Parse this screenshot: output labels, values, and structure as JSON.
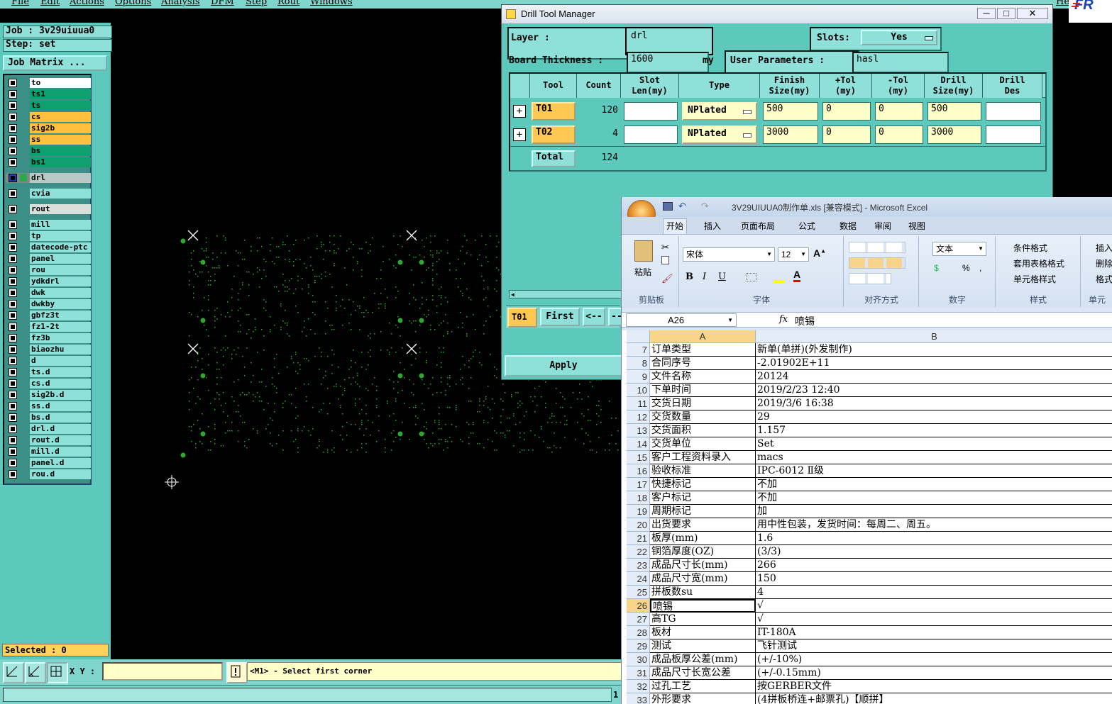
{
  "menubar": {
    "items": [
      "File",
      "Edit",
      "Actions",
      "Options",
      "Analysis",
      "DFM",
      "Step",
      "Rout",
      "Windows"
    ],
    "help": "Help",
    "logo": "FR"
  },
  "left": {
    "job": "Job : 3v29uiuua0",
    "step": "Step: set",
    "job_matrix": "Job Matrix ...",
    "layers": [
      {
        "name": "to",
        "color": "#ffffff"
      },
      {
        "name": "ts1",
        "color": "#10a070"
      },
      {
        "name": "ts",
        "color": "#10a070"
      },
      {
        "name": "cs",
        "color": "#ffc040"
      },
      {
        "name": "sig2b",
        "color": "#ffc040"
      },
      {
        "name": "ss",
        "color": "#ffc040"
      },
      {
        "name": "bs",
        "color": "#10a070"
      },
      {
        "name": "bs1",
        "color": "#10a070"
      },
      {
        "name": "drl",
        "color": "#b8c8c4"
      },
      {
        "name": "cvia",
        "color": "#8fe0d8"
      },
      {
        "name": "rout",
        "color": "#d8e0dc"
      },
      {
        "name": "mill",
        "color": "#8fe0d8"
      },
      {
        "name": "tp",
        "color": "#8fe0d8"
      },
      {
        "name": "datecode-ptc",
        "color": "#8fe0d8"
      },
      {
        "name": "panel",
        "color": "#8fe0d8"
      },
      {
        "name": "rou",
        "color": "#8fe0d8"
      },
      {
        "name": "ydkdrl",
        "color": "#8fe0d8"
      },
      {
        "name": "dwk",
        "color": "#8fe0d8"
      },
      {
        "name": "dwkby",
        "color": "#8fe0d8"
      },
      {
        "name": "gbfz3t",
        "color": "#8fe0d8"
      },
      {
        "name": "fz1-2t",
        "color": "#8fe0d8"
      },
      {
        "name": "fz3b",
        "color": "#8fe0d8"
      },
      {
        "name": "biaozhu",
        "color": "#8fe0d8"
      },
      {
        "name": "d",
        "color": "#8fe0d8"
      },
      {
        "name": "ts.d",
        "color": "#8fe0d8"
      },
      {
        "name": "cs.d",
        "color": "#8fe0d8"
      },
      {
        "name": "sig2b.d",
        "color": "#8fe0d8"
      },
      {
        "name": "ss.d",
        "color": "#8fe0d8"
      },
      {
        "name": "bs.d",
        "color": "#8fe0d8"
      },
      {
        "name": "drl.d",
        "color": "#8fe0d8"
      },
      {
        "name": "rout.d",
        "color": "#8fe0d8"
      },
      {
        "name": "mill.d",
        "color": "#8fe0d8"
      },
      {
        "name": "panel.d",
        "color": "#8fe0d8"
      },
      {
        "name": "rou.d",
        "color": "#8fe0d8"
      }
    ],
    "selected": "Selected : 0"
  },
  "bottom": {
    "xy_label": "X Y :",
    "xy_value": "",
    "message": "<M1> - Select first corner",
    "status_num": "1"
  },
  "dtm": {
    "title": "Drill Tool Manager",
    "layer_label": "Layer          :",
    "layer_value": "drl",
    "slots_label": "Slots:",
    "slots_value": "Yes",
    "thickness_label": "Board Thickness :",
    "thickness_value": "1600",
    "thickness_unit": "my",
    "userparam_label": "User Parameters :",
    "userparam_value": "hasl",
    "headers": [
      "Tool",
      "Count",
      "Slot\nLen(my)",
      "Type",
      "Finish\nSize(my)",
      "+Tol\n(my)",
      "-Tol\n(my)",
      "Drill\nSize(my)",
      "Drill\nDes"
    ],
    "rows": [
      {
        "tool": "T01",
        "count": "120",
        "slot": "",
        "type": "NPlated",
        "finish": "500",
        "ptol": "0",
        "mtol": "0",
        "drill": "500",
        "des": ""
      },
      {
        "tool": "T02",
        "count": "4",
        "slot": "",
        "type": "NPlated",
        "finish": "3000",
        "ptol": "0",
        "mtol": "0",
        "drill": "3000",
        "des": ""
      }
    ],
    "total_label": "Total",
    "total_count": "124",
    "current_tool": "T01",
    "first_btn": "First",
    "prev_btn": "<--",
    "next_btn": "--",
    "apply_btn": "Apply"
  },
  "excel": {
    "title": "3V29UIUUA0制作单.xls  [兼容模式] - Microsoft Excel",
    "tabs": [
      "开始",
      "插入",
      "页面布局",
      "公式",
      "数据",
      "审阅",
      "视图"
    ],
    "font_name": "宋体",
    "font_size": "12",
    "number_format": "文本",
    "paste": "粘贴",
    "groups": [
      "剪贴板",
      "字体",
      "对齐方式",
      "数字",
      "样式",
      "单元"
    ],
    "style_items": [
      "条件格式",
      "套用表格格式",
      "单元格样式"
    ],
    "cell_items": [
      "插入",
      "删除",
      "格式"
    ],
    "namebox": "A26",
    "fx": "fx",
    "formula": "喷锡",
    "col_a": "A",
    "col_b": "B",
    "rows": [
      {
        "n": "7",
        "a": "订单类型",
        "b": "新单(单拼)(外发制作)"
      },
      {
        "n": "8",
        "a": "合同序号",
        "b": "-2.01902E+11"
      },
      {
        "n": "9",
        "a": "文件名称",
        "b": "20124"
      },
      {
        "n": "10",
        "a": "下单时间",
        "b": "2019/2/23 12:40"
      },
      {
        "n": "11",
        "a": "交货日期",
        "b": "2019/3/6 16:38"
      },
      {
        "n": "12",
        "a": "交货数量",
        "b": "29"
      },
      {
        "n": "13",
        "a": "交货面积",
        "b": "1.157"
      },
      {
        "n": "14",
        "a": "交货单位",
        "b": "Set"
      },
      {
        "n": "15",
        "a": "客户工程资料录入",
        "b": "macs"
      },
      {
        "n": "16",
        "a": "验收标准",
        "b": "IPC-6012 Ⅱ级"
      },
      {
        "n": "17",
        "a": "快捷标记",
        "b": "不加"
      },
      {
        "n": "18",
        "a": "客户标记",
        "b": "不加"
      },
      {
        "n": "19",
        "a": "周期标记",
        "b": "加"
      },
      {
        "n": "20",
        "a": "出货要求",
        "b": "用中性包装，发货时间：每周二、周五。"
      },
      {
        "n": "21",
        "a": "板厚(mm)",
        "b": "1.6"
      },
      {
        "n": "22",
        "a": "铜箔厚度(OZ)",
        "b": " (3/3)"
      },
      {
        "n": "23",
        "a": "成品尺寸长(mm)",
        "b": "266"
      },
      {
        "n": "24",
        "a": "成品尺寸宽(mm)",
        "b": "150"
      },
      {
        "n": "25",
        "a": "拼板数su",
        "b": "4"
      },
      {
        "n": "26",
        "a": "喷锡",
        "b": "√"
      },
      {
        "n": "27",
        "a": "高TG",
        "b": "√"
      },
      {
        "n": "28",
        "a": "板材",
        "b": "IT-180A"
      },
      {
        "n": "29",
        "a": "测试",
        "b": "飞针测试"
      },
      {
        "n": "30",
        "a": "成品板厚公差(mm)",
        "b": "(+/-10%)"
      },
      {
        "n": "31",
        "a": "成品尺寸长宽公差",
        "b": "(+/-0.15mm)"
      },
      {
        "n": "32",
        "a": "过孔工艺",
        "b": "按GERBER文件"
      },
      {
        "n": "33",
        "a": "外形要求",
        "b": "(4拼板桥连+邮票孔)【顺拼】"
      }
    ]
  }
}
